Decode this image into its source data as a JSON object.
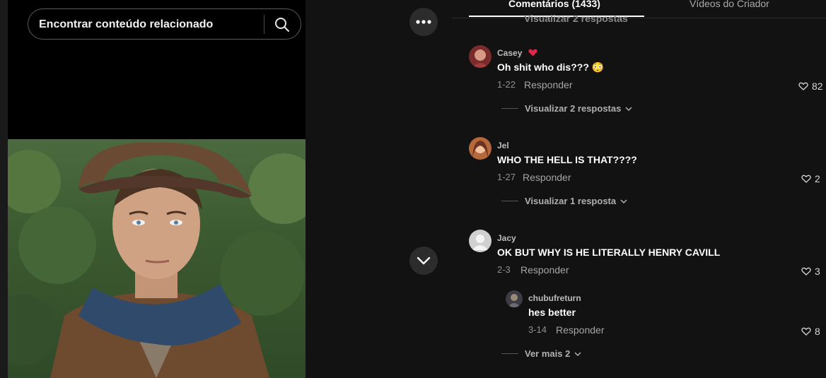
{
  "search": {
    "text": "Encontrar conteúdo relacionado"
  },
  "tabs": {
    "comments": "Comentários (1433)",
    "creator": "Vídeos do Criador"
  },
  "ghost_text": "Visualizar 2 respostas",
  "comments": [
    {
      "user": "Casey",
      "text": "Oh shit who dis??? 😳",
      "date": "1-22",
      "reply": "Responder",
      "likes": "82",
      "view_replies": "Visualizar 2 respostas"
    },
    {
      "user": "Jel",
      "text": "WHO THE HELL IS THAT????",
      "date": "1-27",
      "reply": "Responder",
      "likes": "2",
      "view_replies": "Visualizar 1 resposta"
    },
    {
      "user": "Jacy",
      "text": "OK BUT WHY IS HE LITERALLY HENRY CAVILL",
      "date": "2-3",
      "reply": "Responder",
      "likes": "3"
    }
  ],
  "nested_reply": {
    "user": "chubufreturn",
    "text": "hes better",
    "date": "3-14",
    "reply": "Responder",
    "likes": "8"
  },
  "see_more": "Ver mais 2",
  "colors": {
    "background": "#121212",
    "accent_heart": "#e0284a"
  },
  "icons": [
    "search-icon",
    "more-icon",
    "chevron-down-icon",
    "heart-outline-icon",
    "creator-heart-icon"
  ]
}
